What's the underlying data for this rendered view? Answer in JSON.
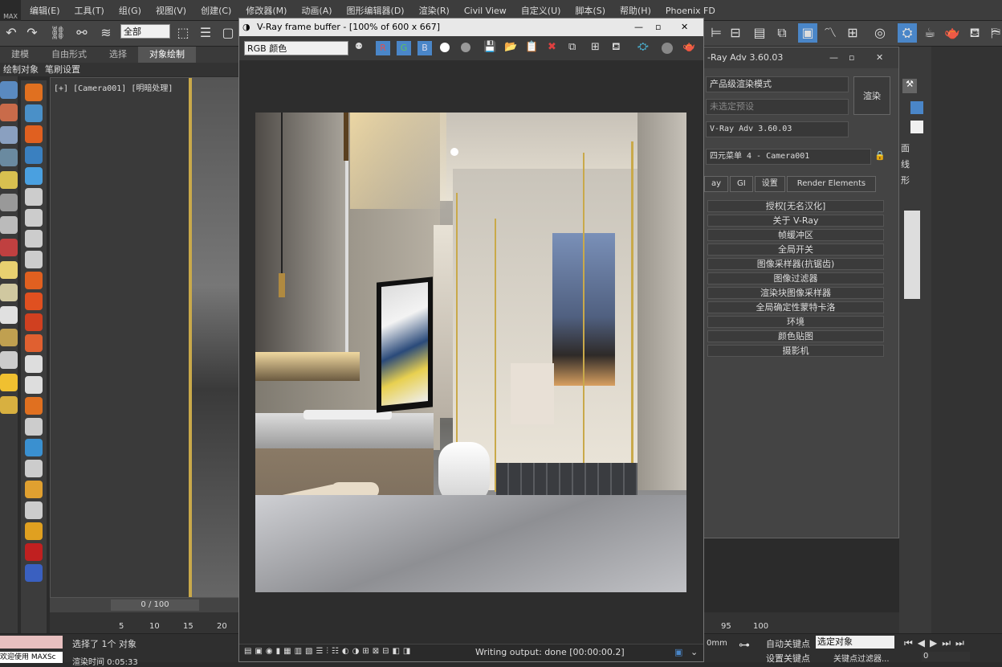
{
  "app": {
    "logo": "MAX"
  },
  "menu": [
    "编辑(E)",
    "工具(T)",
    "组(G)",
    "视图(V)",
    "创建(C)",
    "修改器(M)",
    "动画(A)",
    "图形编辑器(D)",
    "渲染(R)",
    "Civil View",
    "自定义(U)",
    "脚本(S)",
    "帮助(H)",
    "Phoenix FD"
  ],
  "toolbar": {
    "selection_filter": "全部"
  },
  "ribbon": {
    "tabs": [
      "建模",
      "自由形式",
      "选择",
      "对象绘制"
    ],
    "sub": [
      "绘制对象",
      "笔刷设置"
    ]
  },
  "viewport": {
    "label": "[+] [Camera001] [明暗处理]"
  },
  "timeline": {
    "frame": "0 / 100",
    "ticks": [
      "5",
      "10",
      "15",
      "20",
      "95",
      "100"
    ]
  },
  "status": {
    "selected": "选择了 1个 对象",
    "welcome": "欢迎使用 MAXSc",
    "render_time": "渲染时间 0:05:33",
    "autokey": "自动关键点",
    "setkey": "设置关键点",
    "key_mode": "选定对象",
    "key_filter": "关键点过滤器...",
    "spinner": "0",
    "unit": "0mm"
  },
  "vfb": {
    "title": "V-Ray frame buffer - [100% of 600 x 667]",
    "channel": "RGB 颜色",
    "status": "Writing output: done [00:00:00.2]",
    "btn_r": "R",
    "btn_g": "G",
    "btn_b": "B"
  },
  "vray": {
    "title": "-Ray Adv 3.60.03",
    "mode": "产品级渲染模式",
    "preset": "未选定预设",
    "renderer": "V-Ray Adv 3.60.03",
    "view": "四元菜单 4 - Camera001",
    "render_btn": "渲染",
    "tabs": [
      "ay",
      "GI",
      "设置",
      "Render Elements"
    ],
    "rollouts": [
      "授权[无名汉化]",
      "关于 V-Ray",
      "帧缓冲区",
      "全局开关",
      "图像采样器(抗锯齿)",
      "图像过滤器",
      "渲染块图像采样器",
      "全局确定性蒙特卡洛",
      "环境",
      "颜色贴图",
      "摄影机"
    ]
  },
  "rightpanel": {
    "labels": [
      "面",
      "线",
      "形"
    ]
  },
  "colors": {
    "accent": "#4a86c8",
    "gold": "#c9a94a"
  }
}
